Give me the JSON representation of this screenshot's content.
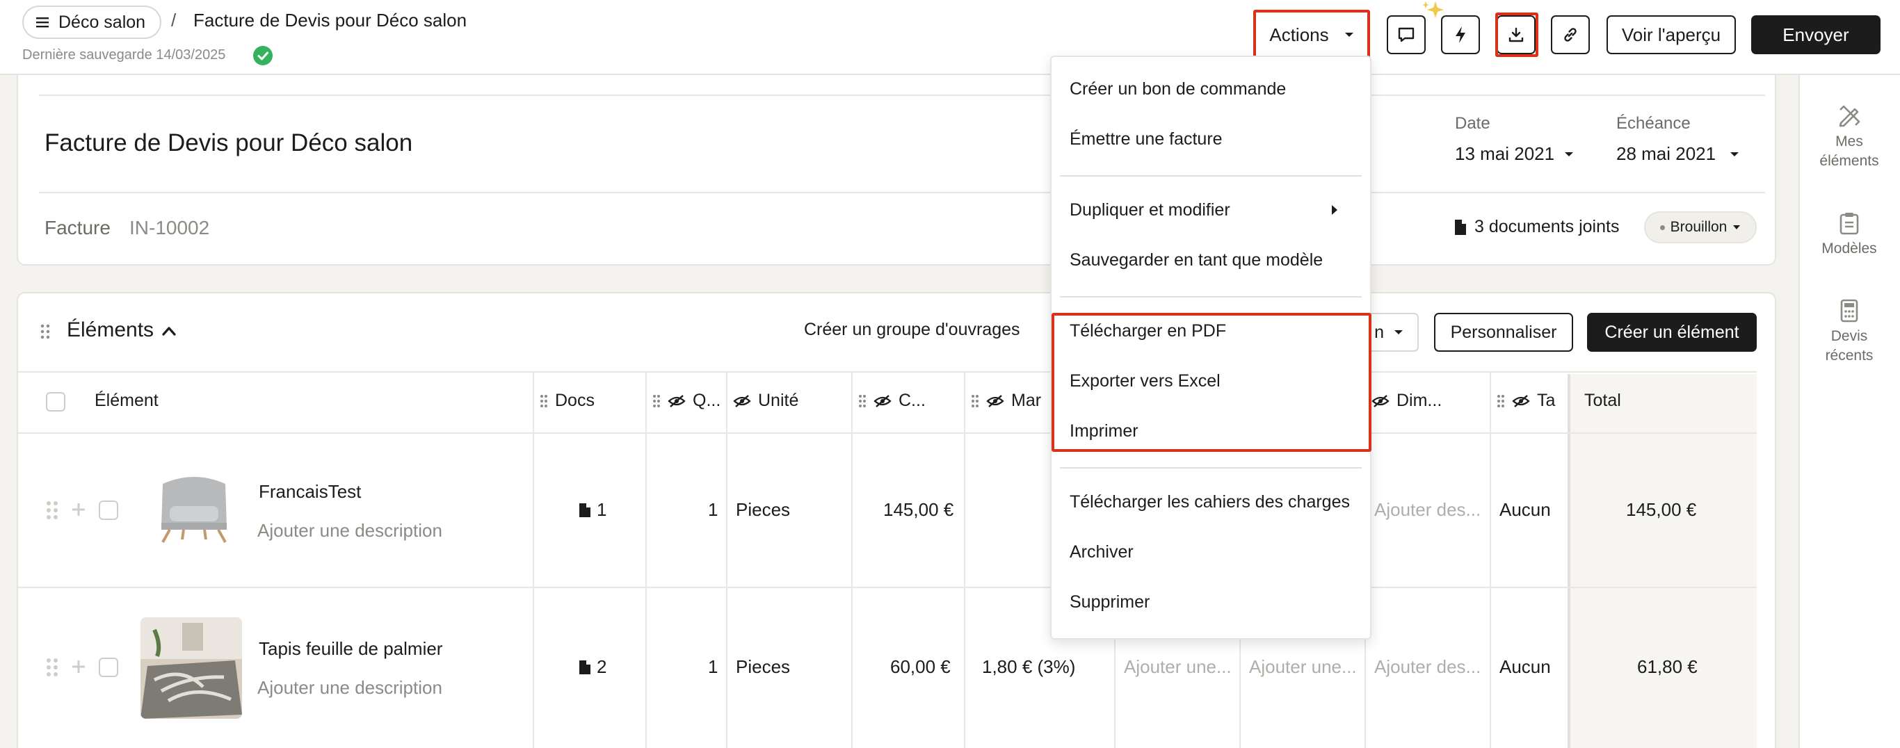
{
  "topbar": {
    "project": "Déco salon",
    "separator": "/",
    "title": "Facture de Devis pour Déco salon",
    "last_saved": "Dernière sauvegarde 14/03/2025",
    "actions_label": "Actions",
    "preview_label": "Voir l'aperçu",
    "send_label": "Envoyer"
  },
  "rail": {
    "mes_elements": "Mes éléments",
    "modeles": "Modèles",
    "devis_recents": "Devis récents"
  },
  "header": {
    "title": "Facture de Devis pour Déco salon",
    "date_label": "Date",
    "date_value": "13 mai 2021",
    "due_label": "Échéance",
    "due_value": "28 mai 2021",
    "type": "Facture",
    "number": "IN-10002",
    "attachments": "3 documents joints",
    "status": "Brouillon"
  },
  "elements": {
    "title": "Éléments",
    "create_group": "Créer un groupe d'ouvrages",
    "hidden_filter_fragment": "n",
    "customize": "Personnaliser",
    "create_item": "Créer un élément",
    "columns": {
      "element": "Élément",
      "docs": "Docs",
      "qty": "Q...",
      "unit": "Unité",
      "cost": "C...",
      "margin": "Mar",
      "dim": "Dim...",
      "tax": "Ta",
      "total": "Total"
    },
    "rows": [
      {
        "name": "FrancaisTest",
        "description": "Ajouter une description",
        "docs": "1",
        "qty": "1",
        "unit": "Pieces",
        "cost": "145,00 €",
        "dim": "Ajouter des...",
        "tax": "Aucun",
        "total": "145,00 €"
      },
      {
        "name": "Tapis feuille de palmier",
        "description": "Ajouter une description",
        "docs": "2",
        "qty": "1",
        "unit": "Pieces",
        "cost": "60,00 €",
        "margin": "1,80 € (3%)",
        "col_a": "Ajouter une...",
        "col_b": "Ajouter une...",
        "dim": "Ajouter des...",
        "tax": "Aucun",
        "total": "61,80 €"
      }
    ]
  },
  "menu": {
    "items": [
      "Créer un bon de commande",
      "Émettre une facture",
      "Dupliquer et modifier",
      "Sauvegarder en tant que modèle",
      "Télécharger en PDF",
      "Exporter vers Excel",
      "Imprimer",
      "Télécharger les cahiers des charges",
      "Archiver",
      "Supprimer"
    ]
  },
  "colors": {
    "highlight": "#d8321d",
    "primary": "#1c1c1c",
    "success": "#34b25c"
  },
  "icons": [
    "hamburger-icon",
    "check-icon",
    "caret-down-icon",
    "comment-icon",
    "bolt-icon",
    "sparkle-icon",
    "download-icon",
    "link-icon",
    "pencil-ruler-icon",
    "clipboard-icon",
    "calculator-icon",
    "document-icon",
    "drag-grip-icon",
    "eye-off-icon",
    "plus-icon",
    "chevron-up-icon",
    "caret-right-icon"
  ]
}
